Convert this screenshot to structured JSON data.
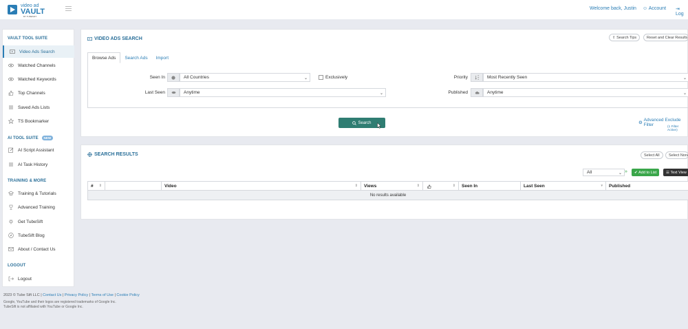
{
  "header": {
    "logo_line1": "video ad",
    "logo_line2": "VAULT",
    "logo_sub": "BY TUBESIFT",
    "welcome": "Welcome back, Justin",
    "account": "Account",
    "logout": "Log"
  },
  "sidebar": {
    "vault_title": "VAULT TOOL SUITE",
    "vault_items": [
      {
        "label": "Video Ads Search",
        "icon": "video-icon"
      },
      {
        "label": "Watched Channels",
        "icon": "eye-icon"
      },
      {
        "label": "Watched Keywords",
        "icon": "eye-icon"
      },
      {
        "label": "Top Channels",
        "icon": "thumbs-up-icon"
      },
      {
        "label": "Saved Ads Lists",
        "icon": "list-icon"
      },
      {
        "label": "TS Bookmarker",
        "icon": "star-icon"
      }
    ],
    "ai_title": "AI TOOL SUITE",
    "ai_badge": "NEW",
    "ai_items": [
      {
        "label": "AI Script Assistant",
        "icon": "edit-icon"
      },
      {
        "label": "AI Task History",
        "icon": "list-icon"
      }
    ],
    "training_title": "TRAINING & MORE",
    "training_items": [
      {
        "label": "Training & Tutorials",
        "icon": "graduation-cap-icon"
      },
      {
        "label": "Advanced Training",
        "icon": "trophy-icon"
      },
      {
        "label": "Get TubeSift",
        "icon": "plug-icon"
      },
      {
        "label": "TubeSift Blog",
        "icon": "compass-icon"
      },
      {
        "label": "About / Contact Us",
        "icon": "envelope-icon"
      }
    ],
    "logout_title": "LOGOUT",
    "logout_item": "Logout"
  },
  "footer": {
    "copyright": "2023 © Tube Sift LLC |",
    "links": [
      "Contact Us",
      "Privacy Policy",
      "Terms of Use",
      "Cookie Policy"
    ],
    "trademark": "Google, YouTube and their logos are registered trademarks of Google Inc.",
    "affiliation": "TubeSift is not affiliated with YouTube or Google Inc."
  },
  "search_panel": {
    "title": "VIDEO ADS SEARCH",
    "search_tips": "Search Tips",
    "reset": "Reset and Clear Results",
    "tabs": [
      "Browse Ads",
      "Search Ads",
      "Import"
    ],
    "seen_in_label": "Seen In",
    "seen_in_value": "All Countries",
    "exclusively_label": "Exclusively",
    "last_seen_label": "Last Seen",
    "last_seen_value": "Anytime",
    "priority_label": "Priority",
    "priority_value": "Most Recently Seen",
    "published_label": "Published",
    "published_value": "Anytime",
    "search_button": "Search",
    "advanced_filter": "Advanced Exclude Filter",
    "filter_active": "(1 Filter Active)"
  },
  "results_panel": {
    "title": "SEARCH RESULTS",
    "select_all": "Select All",
    "select_none": "Select None",
    "list_select": "All",
    "add_to_list": "Add to List",
    "text_view": "Text View",
    "columns": [
      "#",
      "",
      "Video",
      "Views",
      "",
      "Seen In",
      "Last Seen",
      "Published"
    ],
    "empty": "No results available"
  },
  "colors": {
    "accent": "#2a7db5",
    "search_button": "#2f7d72",
    "green": "#3aa64a"
  }
}
